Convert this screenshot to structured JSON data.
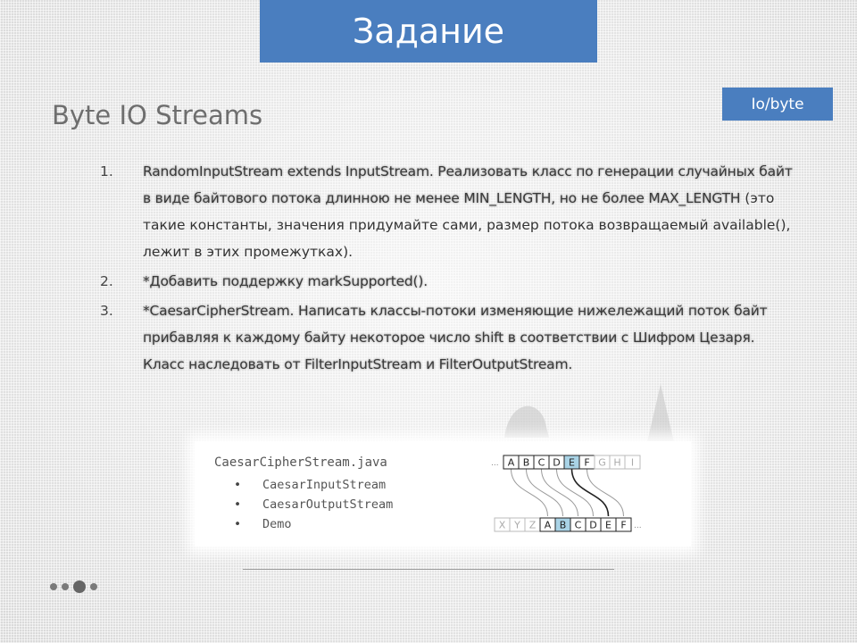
{
  "header": {
    "title": "Задание",
    "tag": "Io/byte",
    "subtitle": "Byte IO Streams"
  },
  "tasks": [
    {
      "num": "1.",
      "blurred_text": "RandomInputStream extends InputStream. Реализовать класс по генерации случайных байт в виде байтового потока длинною не менее MIN_LENGTH, но не более MAX_LENGTH",
      "text": " (это такие константы, значения придумайте сами, размер потока возвращаемый available(), лежит в этих промежутках)."
    },
    {
      "num": "2.",
      "blurred_text": "*Добавить поддержку markSupported().",
      "text": ""
    },
    {
      "num": "3.",
      "blurred_text": "*CaesarCipherStream. Написать классы-потоки изменяющие нижележащий поток байт прибавляя к каждому байту некоторое число shift в соответствии с Шифром Цезаря. Класс наследовать от FilterInputStream и FilterOutputStream.",
      "text": ""
    }
  ],
  "demo": {
    "file": "CaesarCipherStream.java",
    "items": [
      {
        "bullet": "•",
        "label": "CaesarInputStream"
      },
      {
        "bullet": "•",
        "label": "CaesarOutputStream"
      },
      {
        "bullet": "•",
        "label": "Demo"
      }
    ],
    "cipher": {
      "top_row": [
        "A",
        "B",
        "C",
        "D",
        "E",
        "F",
        "G",
        "H",
        "I"
      ],
      "bottom_row": [
        "X",
        "Y",
        "Z",
        "A",
        "B",
        "C",
        "D",
        "E",
        "F"
      ],
      "highlight_top_index": 4,
      "highlight_bottom_index": 4,
      "top_ellipsis": "...",
      "bottom_ellipsis": "...",
      "highlight_color": "#a9d3e6",
      "cell_border_color": "#222222",
      "faded_color": "#bbbbbb"
    }
  },
  "colors": {
    "accent": "#4a7ebf"
  }
}
